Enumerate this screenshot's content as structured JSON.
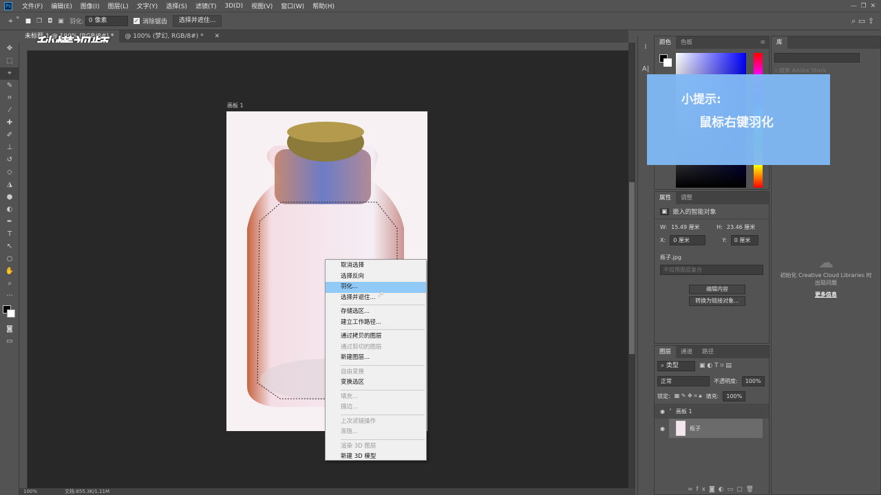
{
  "menu": {
    "app_icon": "Ps",
    "items": [
      "文件(F)",
      "编辑(E)",
      "图像(I)",
      "图层(L)",
      "文字(Y)",
      "选择(S)",
      "滤镜(T)",
      "3D(D)",
      "视图(V)",
      "窗口(W)",
      "帮助(H)"
    ]
  },
  "options": {
    "feather_label": "羽化:",
    "feather_value": "0 像素",
    "antialias_label": "消除锯齿",
    "antialias_checked": true,
    "select_mask_button": "选择并遮住..."
  },
  "tabs": [
    {
      "label": "未标题-1 @ 100% (RGB/8#) *",
      "active": true
    },
    {
      "label": "@ 100% (梦幻, RGB/8#) *",
      "active": false
    }
  ],
  "watermark": "秒懂视频",
  "artboard_label": "画板 1",
  "context_menu": {
    "groups": [
      [
        {
          "label": "取消选择",
          "enabled": true
        },
        {
          "label": "选择反向",
          "enabled": true
        },
        {
          "label": "羽化...",
          "enabled": true,
          "highlighted": true
        },
        {
          "label": "选择并遮住...",
          "enabled": true
        }
      ],
      [
        {
          "label": "存储选区...",
          "enabled": true
        },
        {
          "label": "建立工作路径...",
          "enabled": true
        }
      ],
      [
        {
          "label": "通过拷贝的图层",
          "enabled": true
        },
        {
          "label": "通过剪切的图层",
          "enabled": false
        },
        {
          "label": "新建图层...",
          "enabled": true
        }
      ],
      [
        {
          "label": "自由变换",
          "enabled": false
        },
        {
          "label": "变换选区",
          "enabled": true
        }
      ],
      [
        {
          "label": "填充...",
          "enabled": false
        },
        {
          "label": "描边...",
          "enabled": false
        }
      ],
      [
        {
          "label": "上次滤镜操作",
          "enabled": false
        },
        {
          "label": "渐隐...",
          "enabled": false
        }
      ],
      [
        {
          "label": "渲染 3D 图层",
          "enabled": false
        },
        {
          "label": "新建 3D 模型",
          "enabled": true
        }
      ]
    ]
  },
  "status": {
    "zoom": "100%",
    "doc": "文档:855.3K/1.11M"
  },
  "color_panel": {
    "tabs": [
      "颜色",
      "色板"
    ],
    "hue": "#0000ff"
  },
  "library_panel": {
    "tab": "库",
    "search_placeholder": "搜索 Adobe Stock",
    "error": "初始化 Creative Cloud Libraries 时出现问题",
    "more_info": "更多信息"
  },
  "properties": {
    "tabs": [
      "属性",
      "调整"
    ],
    "type": "嵌入的智能对象",
    "w_label": "W:",
    "w": "15.49 厘米",
    "h_label": "H:",
    "h": "23.46 厘米",
    "x_label": "X:",
    "x": "0 厘米",
    "y_label": "Y:",
    "y": "0 厘米",
    "file": "瓶子.jpg",
    "comp": "不应用图层复合",
    "edit_btn": "编辑内容",
    "convert_btn": "转换为链接对象..."
  },
  "layers": {
    "tabs": [
      "图层",
      "通道",
      "路径"
    ],
    "filter": "类型",
    "blend": "正常",
    "opacity_label": "不透明度:",
    "opacity": "100%",
    "lock_label": "锁定:",
    "fill_label": "填充:",
    "fill": "100%",
    "items": [
      {
        "name": "画板 1",
        "group": true
      },
      {
        "name": "瓶子",
        "group": false,
        "selected": true
      }
    ]
  },
  "tip": {
    "title": "小提示:",
    "body": "鼠标右键羽化"
  }
}
